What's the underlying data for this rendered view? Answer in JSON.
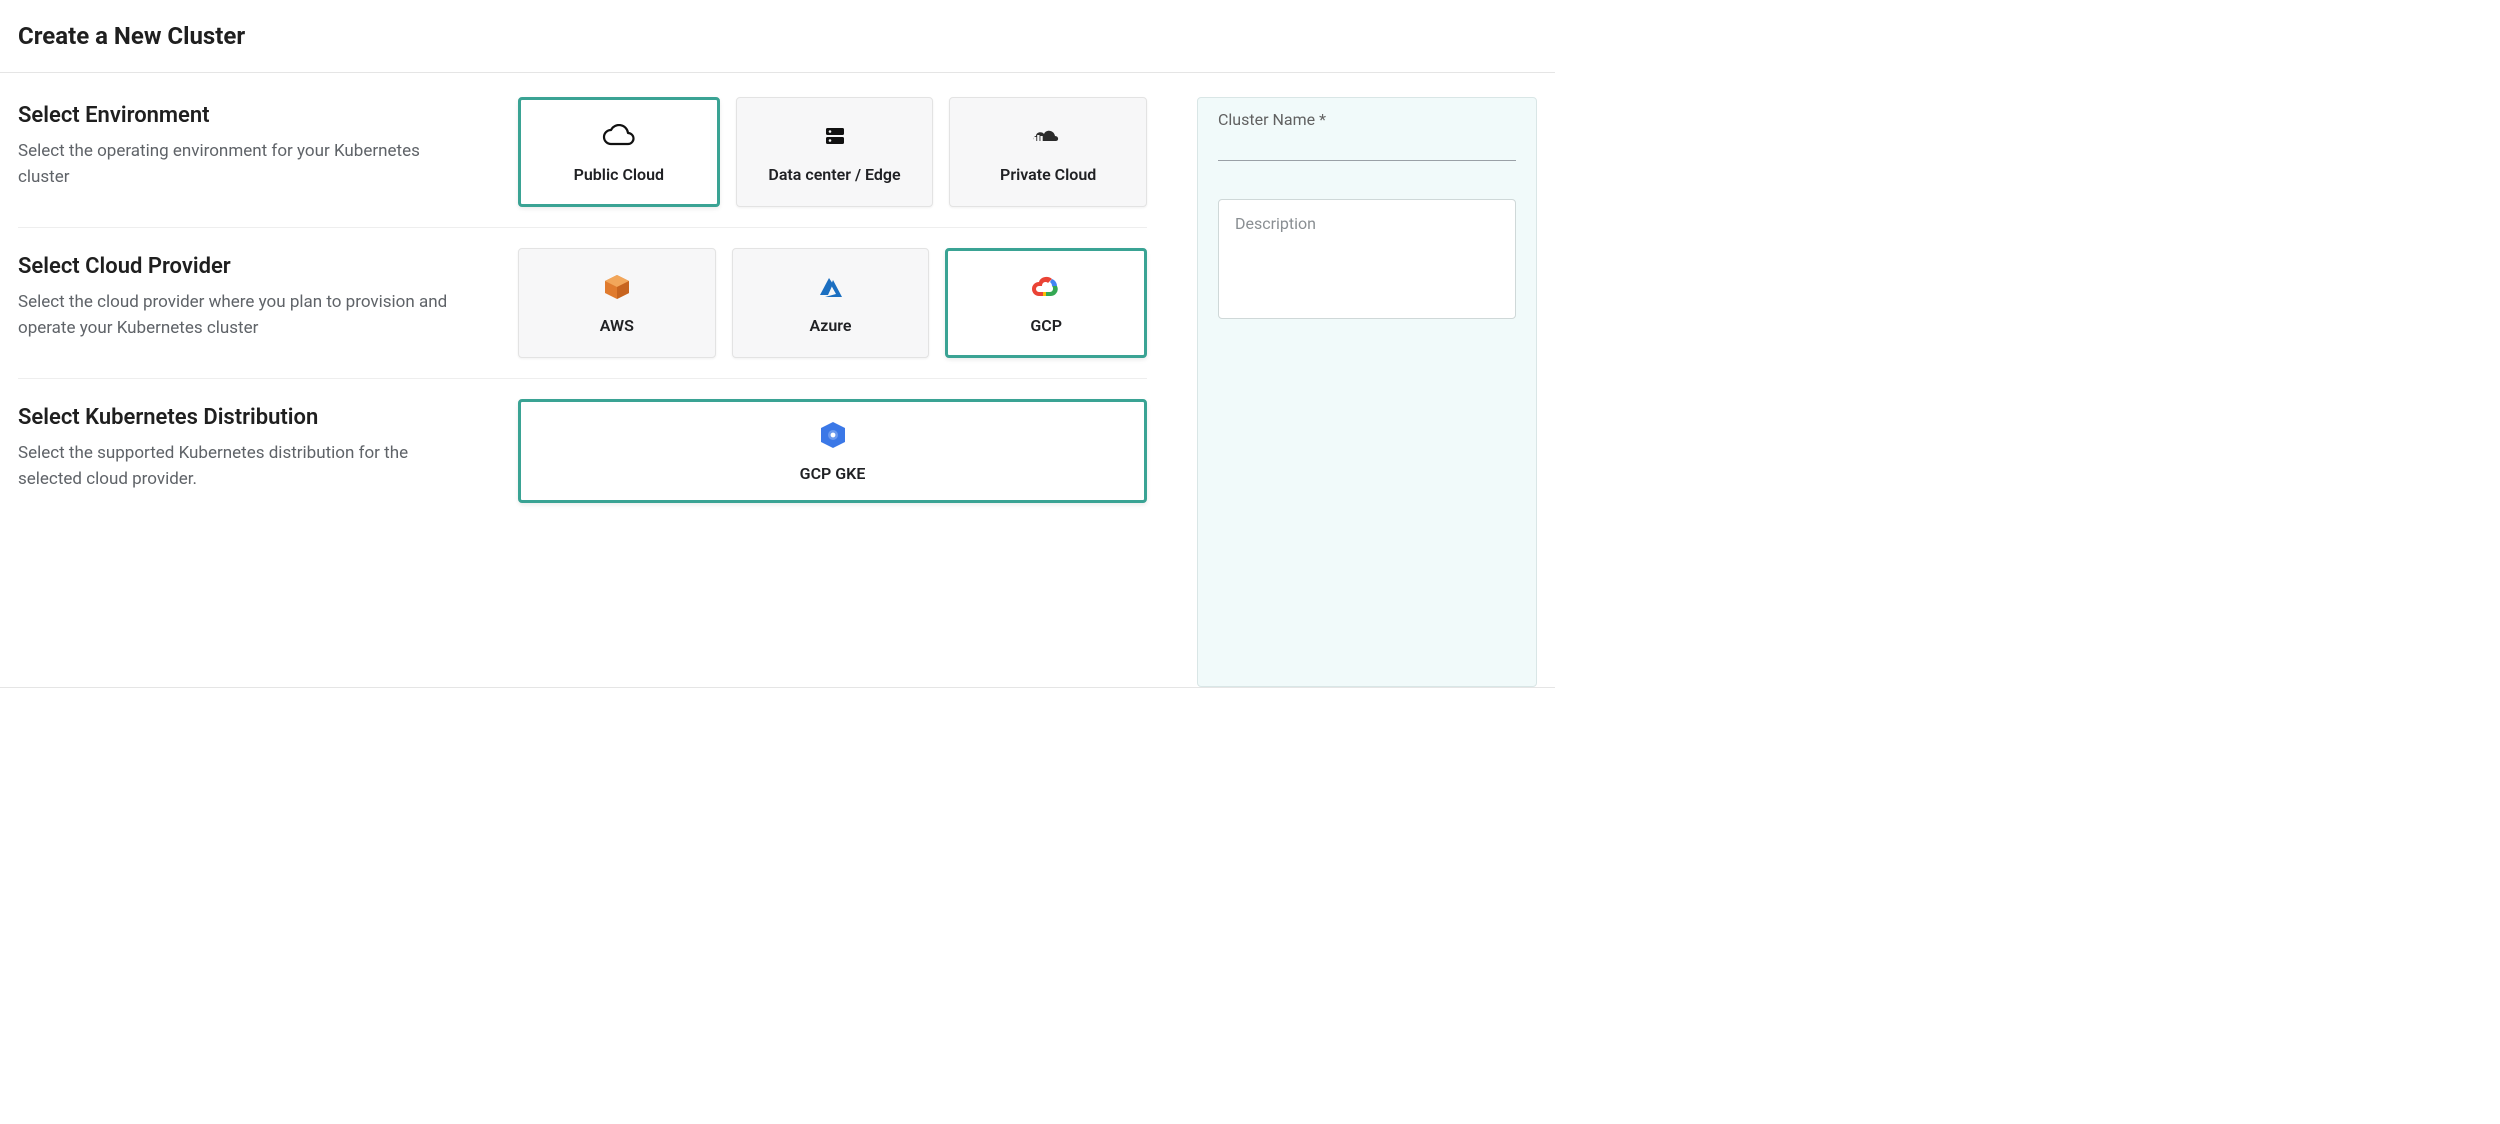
{
  "page": {
    "title": "Create a New Cluster"
  },
  "sections": {
    "environment": {
      "title": "Select Environment",
      "desc": "Select the operating environment for your Kubernetes cluster",
      "options": {
        "public_cloud": "Public Cloud",
        "data_center": "Data center / Edge",
        "private_cloud": "Private Cloud"
      },
      "selected": "public_cloud"
    },
    "provider": {
      "title": "Select Cloud Provider",
      "desc": "Select the cloud provider where you plan to provision and operate your Kubernetes cluster",
      "options": {
        "aws": "AWS",
        "azure": "Azure",
        "gcp": "GCP"
      },
      "selected": "gcp"
    },
    "distribution": {
      "title": "Select Kubernetes Distribution",
      "desc": "Select the supported Kubernetes distribution for the selected cloud provider.",
      "options": {
        "gcp_gke": "GCP GKE"
      },
      "selected": "gcp_gke"
    }
  },
  "side": {
    "cluster_name_label": "Cluster Name *",
    "cluster_name_value": "",
    "description_placeholder": "Description",
    "description_value": ""
  }
}
